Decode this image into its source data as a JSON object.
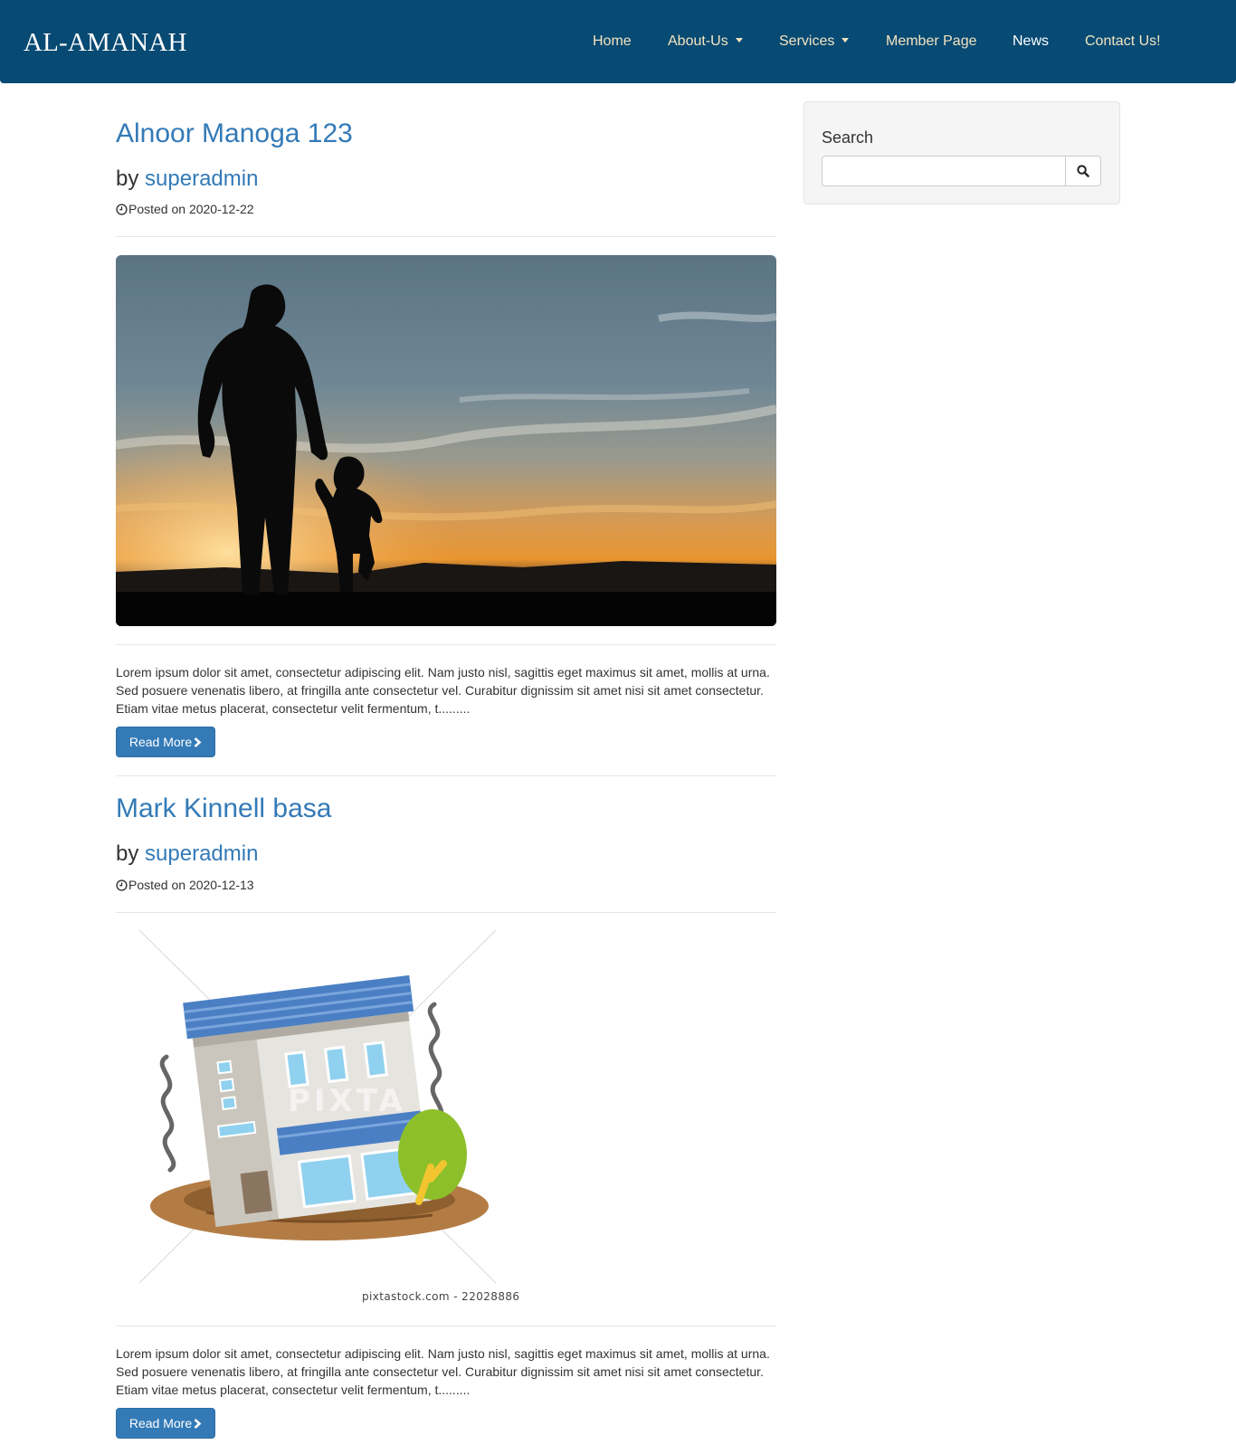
{
  "header": {
    "brand": "AL-AMANAH",
    "nav": [
      {
        "label": "Home"
      },
      {
        "label": "About-Us"
      },
      {
        "label": "Services"
      },
      {
        "label": "Member Page"
      },
      {
        "label": "News"
      },
      {
        "label": "Contact Us!"
      }
    ]
  },
  "sidebar": {
    "search_title": "Search",
    "search_value": ""
  },
  "posts": [
    {
      "title": "Alnoor Manoga 123",
      "by": "by",
      "author": "superadmin",
      "date": "Posted on 2020-12-22",
      "excerpt": "Lorem ipsum dolor sit amet, consectetur adipiscing elit. Nam justo nisl, sagittis eget maximus sit amet, mollis at urna. Sed posuere venenatis libero, at fringilla ante consectetur vel. Curabitur dignissim sit amet nisi sit amet consectetur. Etiam vitae metus placerat, consectetur velit fermentum, t.........",
      "read_more": "Read More"
    },
    {
      "title": "Mark Kinnell basa",
      "by": "by",
      "author": "superadmin",
      "date": "Posted on 2020-12-13",
      "image_caption": "pixtastock.com - 22028886",
      "image_watermark": "PIXTA",
      "excerpt": "Lorem ipsum dolor sit amet, consectetur adipiscing elit. Nam justo nisl, sagittis eget maximus sit amet, mollis at urna. Sed posuere venenatis libero, at fringilla ante consectetur vel. Curabitur dignissim sit amet nisi sit amet consectetur. Etiam vitae metus placerat, consectetur velit fermentum, t.........",
      "read_more": "Read More"
    }
  ],
  "colors": {
    "navbar": "#074a73",
    "nav_link": "#f4e4c1",
    "link": "#337ab7",
    "button": "#337ab7"
  }
}
